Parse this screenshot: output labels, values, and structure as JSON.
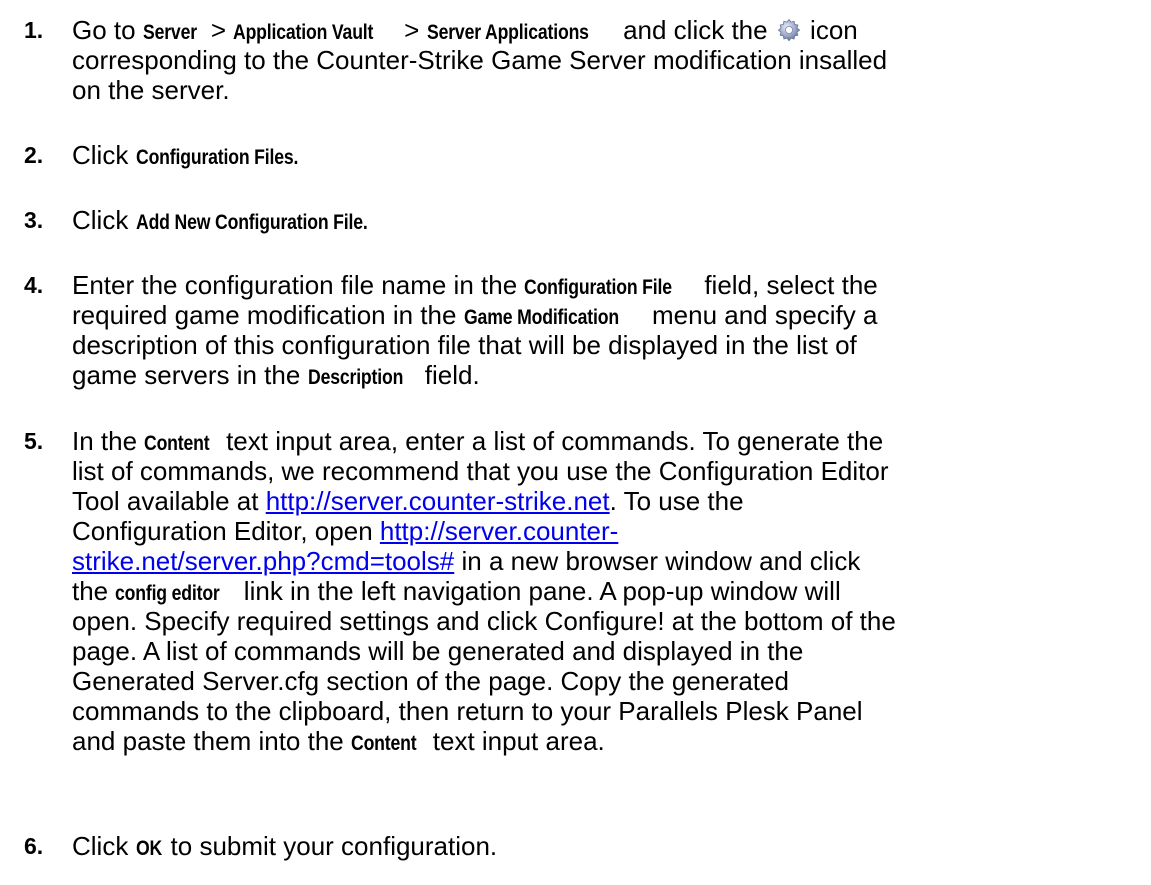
{
  "steps": [
    {
      "num": "1.",
      "t1": "Go to ",
      "b1": "Server",
      "t2": " > ",
      "b2": "Application Vault",
      "t3": " > ",
      "b3": "Server Applications",
      "t4": " and click the ",
      "icon": "gear-icon",
      "t5": " icon",
      "line2": "corresponding to the Counter-Strike Game Server modification insalled",
      "line3": "on the server."
    },
    {
      "num": "2.",
      "t1": "Click ",
      "b1": "Configuration Files."
    },
    {
      "num": "3.",
      "t1": "Click ",
      "b1": "Add New Configuration File."
    },
    {
      "num": "4.",
      "t1": "Enter the configuration file name in the ",
      "b1": "Configuration File",
      "t2": " field, select the",
      "l2a": "required game modification in the ",
      "b2": "Game Modification",
      "l2b": " menu and specify a",
      "line3": "description of this configuration file that will be displayed in the list of",
      "l4a": "game servers in the ",
      "b3": "Description",
      "l4b": " field."
    },
    {
      "num": "5.",
      "l1a": "In the ",
      "b1": "Content",
      "l1b": " text input area, enter a list of commands. To generate the",
      "line2": "list of commands, we recommend that you use the Configuration Editor",
      "l3a": "Tool available at ",
      "link1": "http://server.counter-strike.net",
      "l3b": ". To use the",
      "l4a": "Configuration Editor, open ",
      "link2a": "http://server.counter-",
      "link2b": "strike.net/server.php?cmd=tools#",
      "l5b": " in a new browser window and click",
      "l6a": "the ",
      "b2": "config editor",
      "l6b": " link in the left navigation pane. A pop-up window will",
      "line7": "open. Specify required settings and click Configure! at the bottom of the",
      "line8": "page. A list of commands will be generated and displayed in the",
      "line9": "Generated Server.cfg section of the page. Copy the generated",
      "line10": "commands to the clipboard, then return to your Parallels Plesk Panel",
      "l11a": "and paste them into the ",
      "b3": "Content",
      "l11b": " text input area."
    },
    {
      "num": "6.",
      "t1": "Click ",
      "b1": "OK",
      "t2": " to submit your configuration."
    }
  ],
  "colors": {
    "link": "#0000ee",
    "text": "#000000",
    "gear": "#8a96b8"
  }
}
